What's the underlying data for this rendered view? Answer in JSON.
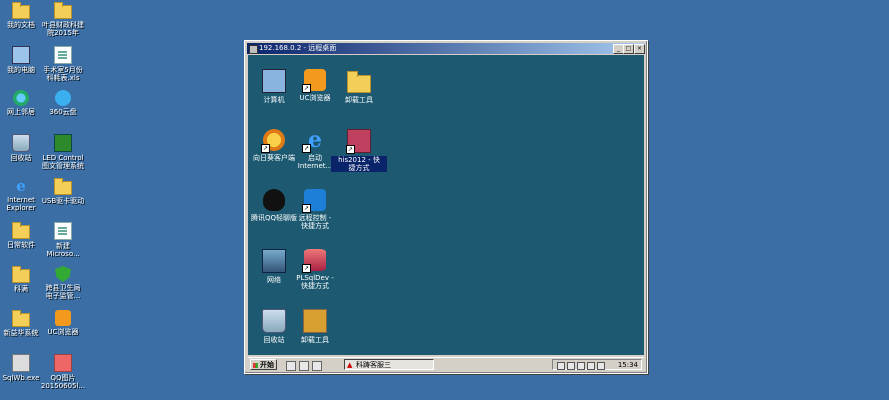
{
  "desktop": {
    "icons": [
      {
        "label": "我的文档",
        "icon": "documents-folder-icon"
      },
      {
        "label": "叶县财政科建\n院2015年",
        "icon": "folder-icon"
      },
      {
        "label": "我的电脑",
        "icon": "computer-icon"
      },
      {
        "label": "手术室5月份\n科耗表.xls",
        "icon": "excel-file-icon"
      },
      {
        "label": "网上邻居",
        "icon": "network-icon"
      },
      {
        "label": "360云盘",
        "icon": "cloud-icon"
      },
      {
        "label": "回收站",
        "icon": "recycle-bin-icon"
      },
      {
        "label": "LED Control\n图文管理系统",
        "icon": "led-control-icon"
      },
      {
        "label": "Internet\nExplorer",
        "icon": "ie-icon"
      },
      {
        "label": "USB驱卡驱动",
        "icon": "folder-icon"
      },
      {
        "label": "日常软件",
        "icon": "folder-icon"
      },
      {
        "label": "新建\nMicroso...",
        "icon": "word-file-icon"
      },
      {
        "label": "科满",
        "icon": "folder-icon"
      },
      {
        "label": "跨县卫生局\n电子监管...",
        "icon": "shield-icon"
      },
      {
        "label": "新益华系统",
        "icon": "folder-icon"
      },
      {
        "label": "UC浏览器",
        "icon": "uc-browser-icon"
      },
      {
        "label": "SqlWb.exe",
        "icon": "exe-icon"
      },
      {
        "label": "QQ图片\n20150605l...",
        "icon": "image-file-icon"
      }
    ]
  },
  "window": {
    "title": "192.168.0.2 - 远程桌面",
    "buttons": {
      "minimize": "_",
      "maximize": "□",
      "close": "×"
    }
  },
  "remote": {
    "icons": [
      {
        "label": "计算机",
        "icon": "computer-icon"
      },
      {
        "label": "UC浏览器",
        "icon": "uc-browser-icon"
      },
      {
        "label": "卸载工具",
        "icon": "folder-icon"
      },
      {
        "label": "向日葵客户端",
        "icon": "sunflower-icon"
      },
      {
        "label": "启动\nInternet...",
        "icon": "ie-icon"
      },
      {
        "label": "his2012 - 快\n捷方式",
        "icon": "his-icon"
      },
      {
        "label": "腾讯QQ轻聊版",
        "icon": "qq-icon"
      },
      {
        "label": "远程控制 -\n快捷方式",
        "icon": "teamviewer-icon"
      },
      {
        "label": "网络",
        "icon": "network-icon"
      },
      {
        "label": "PLSqlDev -\n快捷方式",
        "icon": "plsql-icon"
      },
      {
        "label": "回收站",
        "icon": "recycle-bin-icon"
      },
      {
        "label": "卸载工具",
        "icon": "archive-icon"
      }
    ],
    "taskbar": {
      "start_label": "开始",
      "task_label": "科踌客服三",
      "clock": "15:34"
    }
  }
}
